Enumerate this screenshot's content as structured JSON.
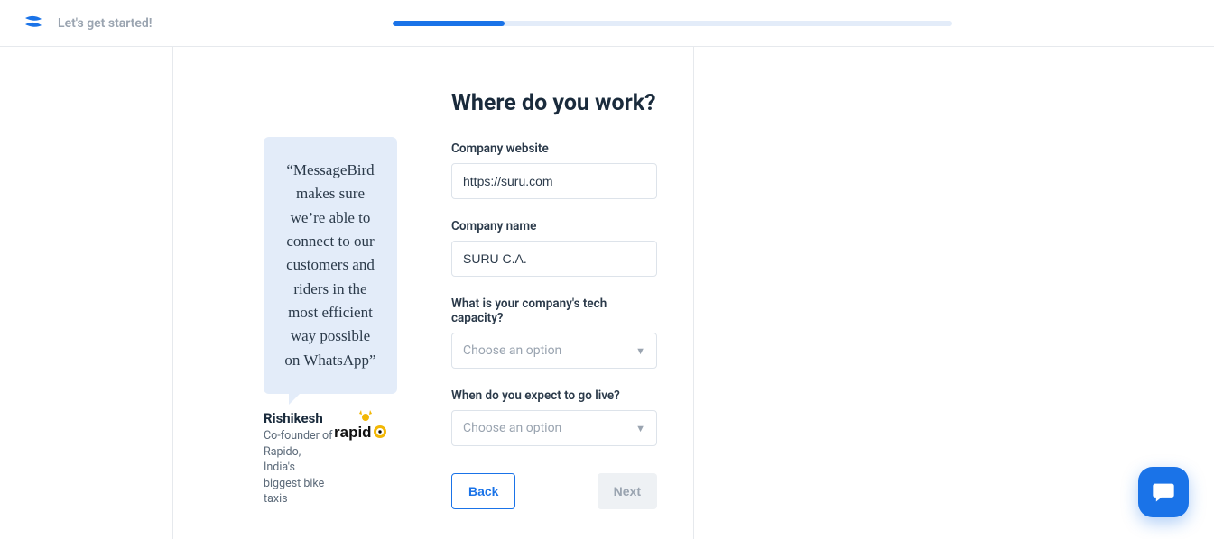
{
  "header": {
    "title": "Let's get started!",
    "progress_percent": 20
  },
  "testimonial": {
    "quote": "“MessageBird makes sure we’re able to connect to our customers and riders in the most efficient way possible on WhatsApp”",
    "name": "Rishikesh",
    "role_line1": "Co-founder of Rapido,",
    "role_line2": "India's biggest bike taxis",
    "brand": "rapido"
  },
  "form": {
    "title": "Where do you work?",
    "company_website": {
      "label": "Company website",
      "value": "https://suru.com"
    },
    "company_name": {
      "label": "Company name",
      "value": "SURU C.A."
    },
    "tech_capacity": {
      "label": "What is your company's tech capacity?",
      "placeholder": "Choose an option"
    },
    "go_live": {
      "label": "When do you expect to go live?",
      "placeholder": "Choose an option"
    },
    "back_label": "Back",
    "next_label": "Next"
  }
}
